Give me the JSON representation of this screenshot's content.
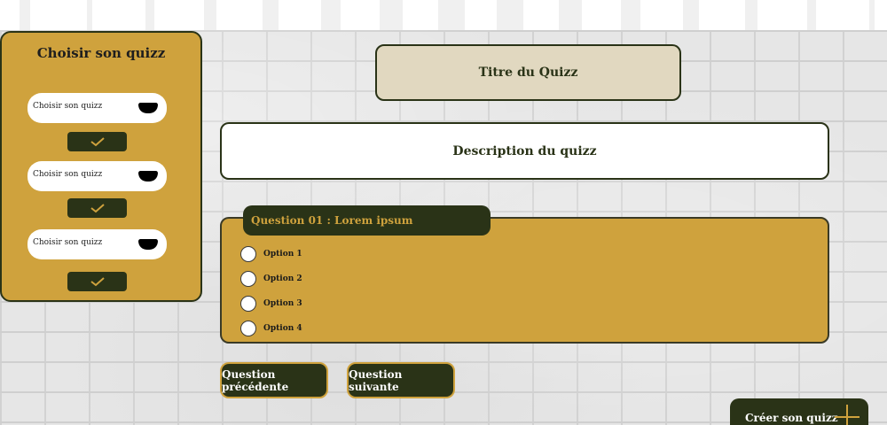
{
  "sidebar": {
    "title": "Choisir son quizz",
    "selects": [
      {
        "value": "Choisir son quizz"
      },
      {
        "value": "Choisir son quizz"
      },
      {
        "value": "Choisir son quizz"
      }
    ]
  },
  "quiz": {
    "title": "Titre du Quizz",
    "description": "Description du quizz"
  },
  "question": {
    "header": "Question 01 :  Lorem ipsum",
    "options": [
      "Option 1",
      "Option 2",
      "Option 3",
      "Option 4"
    ]
  },
  "navigation": {
    "previous_label": "Question précédente",
    "next_label": "Question suivante",
    "create_label": "Créer son quizz"
  },
  "colors": {
    "accent": "#cfa23d",
    "dark": "#2a3317"
  }
}
